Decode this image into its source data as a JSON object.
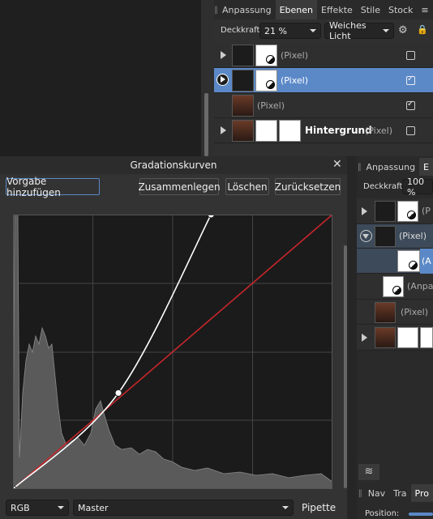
{
  "layers_panel": {
    "tabs": [
      "Anpassung",
      "Ebenen",
      "Effekte",
      "Stile",
      "Stock"
    ],
    "active_tab": "Ebenen",
    "opacity_label": "Deckkraft:",
    "opacity_value": "21 %",
    "blend_mode": "Weiches Licht",
    "layers": [
      {
        "name": "(Pixel)",
        "checked": false,
        "selected": false
      },
      {
        "name": "(Pixel)",
        "checked": true,
        "selected": true
      },
      {
        "name": "(Pixel)",
        "checked": true,
        "selected": false
      },
      {
        "name": "Hintergrund",
        "suffix": "(Pixel)",
        "checked": false,
        "selected": false
      }
    ]
  },
  "curves_dialog": {
    "title": "Gradationskurven",
    "buttons": {
      "add_preset": "Vorgabe hinzufügen",
      "merge": "Zusammenlegen",
      "delete": "Löschen",
      "reset": "Zurücksetzen"
    },
    "channel_mode": "RGB",
    "channel": "Master",
    "picker": "Pipette",
    "curve_points": [
      {
        "input": 0,
        "output": 0
      },
      {
        "input": 0.33,
        "output": 0.35
      },
      {
        "input": 0.62,
        "output": 1.0
      }
    ]
  },
  "right_panel": {
    "tabs": [
      "Anpassung",
      "E"
    ],
    "opacity_label": "Deckkraft:",
    "opacity_value": "100 %",
    "layers": [
      "(P",
      "(Pixel)",
      "(A",
      "(Anpa",
      "(Pixel)",
      ""
    ],
    "bottom_tabs": [
      "Nav",
      "Tra",
      "Pro"
    ],
    "position_label": "Position:"
  }
}
